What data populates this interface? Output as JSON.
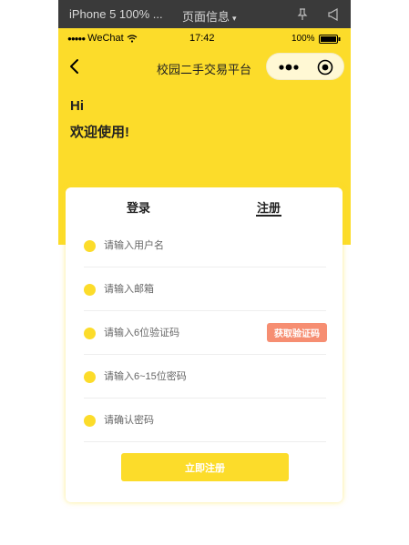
{
  "devtools": {
    "device": "iPhone 5 100% ...",
    "page_info": "页面信息",
    "page_info_caret": "▾"
  },
  "statusbar": {
    "signal_dots": "●●●●●",
    "carrier": "WeChat",
    "time": "17:42",
    "battery": "100%"
  },
  "navbar": {
    "title": "校园二手交易平台"
  },
  "greeting": {
    "hi": "Hi",
    "welcome": "欢迎使用!"
  },
  "tabs": [
    {
      "label": "登录",
      "active": false
    },
    {
      "label": "注册",
      "active": true
    }
  ],
  "form": {
    "fields": [
      {
        "placeholder": "请输入用户名",
        "value": ""
      },
      {
        "placeholder": "请输入邮箱",
        "value": ""
      },
      {
        "placeholder": "请输入6位验证码",
        "value": ""
      },
      {
        "placeholder": "请输入6~15位密码",
        "value": ""
      },
      {
        "placeholder": "请确认密码",
        "value": ""
      }
    ],
    "get_code_label": "获取验证码",
    "submit_label": "立即注册"
  },
  "colors": {
    "accent": "#fcdc2a",
    "code_button": "#f68e72",
    "devtools_bar": "#3a3a3a"
  },
  "icons": {
    "back": "back-arrow-icon",
    "more": "more-dots-icon",
    "close": "capsule-close-icon",
    "field": "yellow-dot-icon",
    "pin": "pin-icon",
    "sound": "sound-icon",
    "wifi": "wifi-icon",
    "battery": "battery-icon"
  }
}
